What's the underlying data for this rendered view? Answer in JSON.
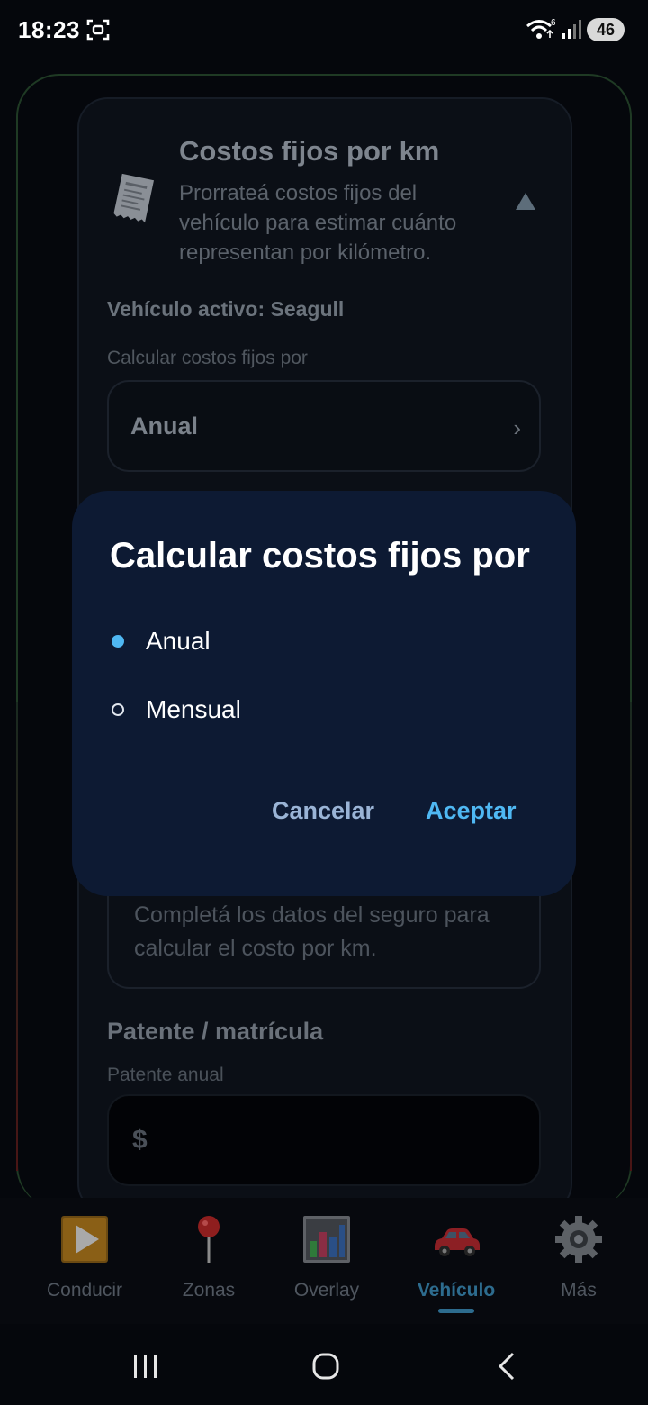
{
  "status_bar": {
    "time": "18:23",
    "wifi_badge": "6",
    "battery": "46"
  },
  "card": {
    "title": "Costos fijos por km",
    "description": "Prorrateá costos fijos del vehículo para estimar cuánto representan por kilómetro.",
    "vehicle_active": "Vehículo activo: Seagull",
    "calc_label": "Calcular costos fijos por",
    "calc_value": "Anual",
    "calc_chevron": "›",
    "insurance_hint": "Completá los datos del seguro para calcular el costo por km.",
    "plate_title": "Patente / matrícula",
    "plate_label": "Patente anual",
    "plate_currency": "$"
  },
  "dialog": {
    "title": "Calcular costos fijos por",
    "options": [
      {
        "label": "Anual",
        "selected": true
      },
      {
        "label": "Mensual",
        "selected": false
      }
    ],
    "cancel_label": "Cancelar",
    "accept_label": "Aceptar"
  },
  "bottom_nav": {
    "items": [
      {
        "label": "Conducir",
        "icon": "play-icon",
        "active": false
      },
      {
        "label": "Zonas",
        "icon": "pin-icon",
        "active": false
      },
      {
        "label": "Overlay",
        "icon": "bar-chart-icon",
        "active": false
      },
      {
        "label": "Vehículo",
        "icon": "car-icon",
        "active": true
      },
      {
        "label": "Más",
        "icon": "gear-icon",
        "active": false
      }
    ]
  },
  "colors": {
    "accent": "#4fb8f3",
    "dialog_bg": "#0d1a33",
    "nav_active": "#2d6c8e"
  }
}
